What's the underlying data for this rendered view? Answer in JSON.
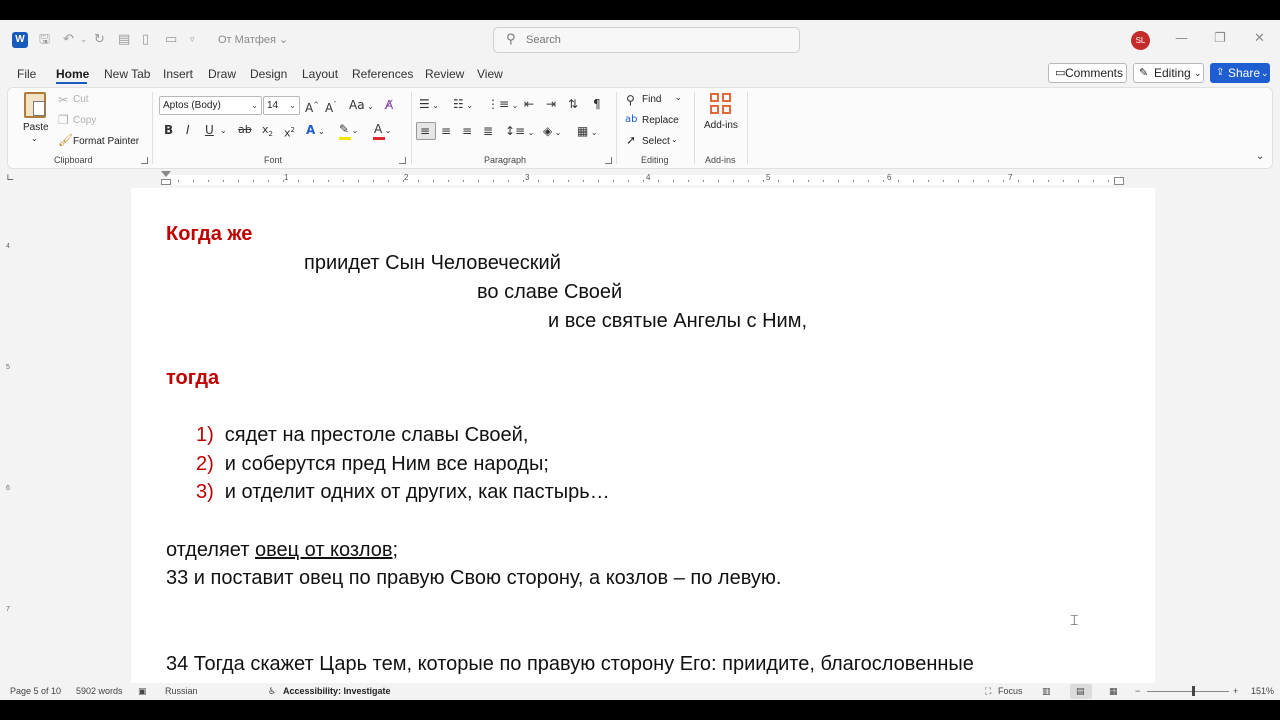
{
  "titlebar": {
    "doc_title": "От Матфея",
    "search_placeholder": "Search",
    "avatar_initials": "SL",
    "minimize": "—",
    "restore": "❐",
    "close": "✕"
  },
  "menu": {
    "tabs": [
      "File",
      "Home",
      "New Tab",
      "Insert",
      "Draw",
      "Design",
      "Layout",
      "References",
      "Review",
      "View"
    ],
    "comments": "Comments",
    "editing": "Editing",
    "share": "Share"
  },
  "ribbon": {
    "clipboard": {
      "paste": "Paste",
      "cut": "Cut",
      "copy": "Copy",
      "format_painter": "Format Painter",
      "label": "Clipboard"
    },
    "font": {
      "font_name": "Aptos (Body)",
      "font_size": "14",
      "label": "Font"
    },
    "paragraph": {
      "label": "Paragraph"
    },
    "editing": {
      "find": "Find",
      "replace": "Replace",
      "select": "Select",
      "label": "Editing"
    },
    "addins": {
      "addins": "Add-ins",
      "label": "Add-ins"
    }
  },
  "ruler": {
    "numbers": [
      "1",
      "2",
      "3",
      "4",
      "5",
      "6",
      "7"
    ],
    "vnumbers": [
      "4",
      "5",
      "6",
      "7"
    ]
  },
  "document": {
    "l1": "Когда же",
    "l2": "приидет Сын Человеческий",
    "l3": "во славе Своей",
    "l4": "и все святые Ангелы с Ним,",
    "l5": "тогда",
    "list": [
      {
        "num": "1)",
        "text": "сядет на престоле славы Своей,"
      },
      {
        "num": "2)",
        "text": "и соберутся пред Ним все народы;"
      },
      {
        "num": "3)",
        "text": "и отделит одних от других, как пастырь…"
      }
    ],
    "l9a": "отделяет ",
    "l9b": "овец от козлов",
    "l9c": ";",
    "l10": "33 и поставит овец по правую Свою сторону, а козлов – по левую.",
    "l11": "34 Тогда скажет Царь тем, которые по правую сторону Его: приидите, благословенные"
  },
  "status": {
    "page": "Page 5 of 10",
    "words": "5902 words",
    "language": "Russian",
    "accessibility": "Accessibility: Investigate",
    "focus": "Focus",
    "zoom": "151%"
  }
}
